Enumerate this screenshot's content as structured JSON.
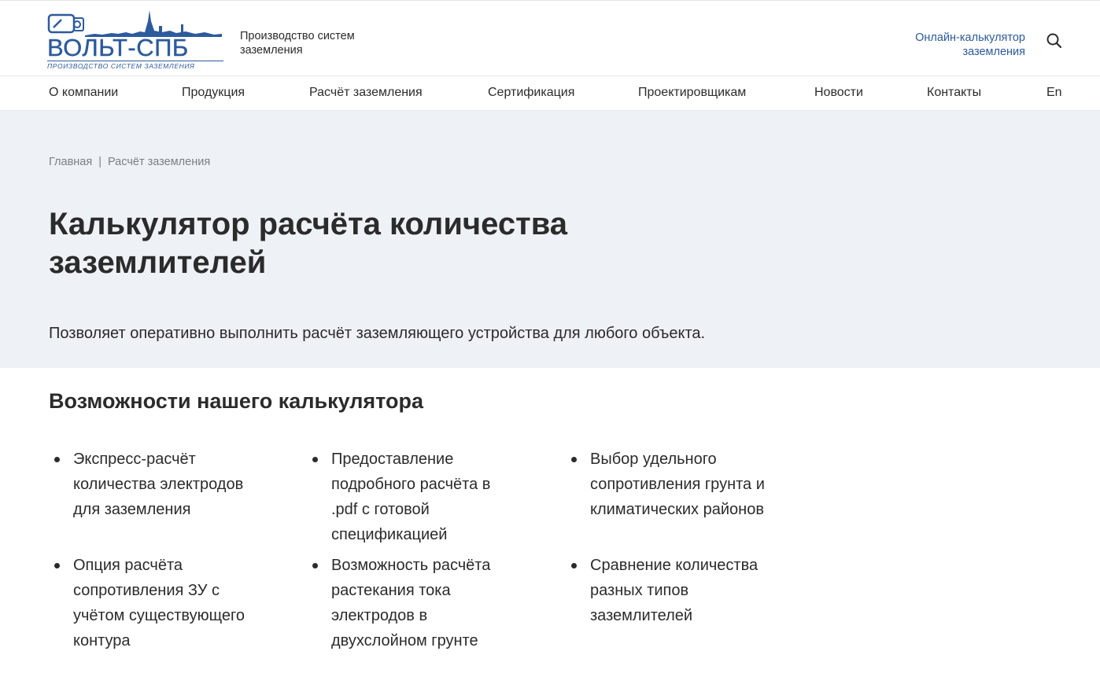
{
  "header": {
    "logo_text": "ВОЛЬТ-СПБ",
    "logo_subtitle": "ПРОИЗВОДСТВО СИСТЕМ ЗАЗЕМЛЕНИЯ",
    "tagline": "Производство систем заземления",
    "calc_link": "Онлайн-калькулятор заземления",
    "search_icon": "search-icon",
    "brand_color": "#2d5a9c"
  },
  "nav": {
    "items": [
      {
        "label": "О компании"
      },
      {
        "label": "Продукция"
      },
      {
        "label": "Расчёт заземления"
      },
      {
        "label": "Сертификация"
      },
      {
        "label": "Проектировщикам"
      },
      {
        "label": "Новости"
      },
      {
        "label": "Контакты"
      },
      {
        "label": "En"
      }
    ]
  },
  "hero": {
    "breadcrumb": {
      "home": "Главная",
      "separator": "|",
      "current": "Расчёт заземления"
    },
    "title": "Калькулятор расчёта количества заземлителей",
    "lead": "Позволяет оперативно выполнить расчёт заземляющего устройства для любого объекта.",
    "background": "#eef1f5"
  },
  "features": {
    "title": "Возможности нашего калькулятора",
    "items": [
      {
        "text": "Экспресс-расчёт количества электродов для заземления"
      },
      {
        "text": "Предоставление подробного расчёта в .pdf с готовой спецификацией"
      },
      {
        "text": "Выбор удельного сопротивления грунта и климатических районов"
      },
      {
        "text": "Опция расчёта сопротивления ЗУ с учётом существующего контура"
      },
      {
        "text": "Возможность расчёта растекания тока электродов в двухслойном грунте"
      },
      {
        "text": "Сравнение количества разных типов заземлителей"
      }
    ]
  }
}
